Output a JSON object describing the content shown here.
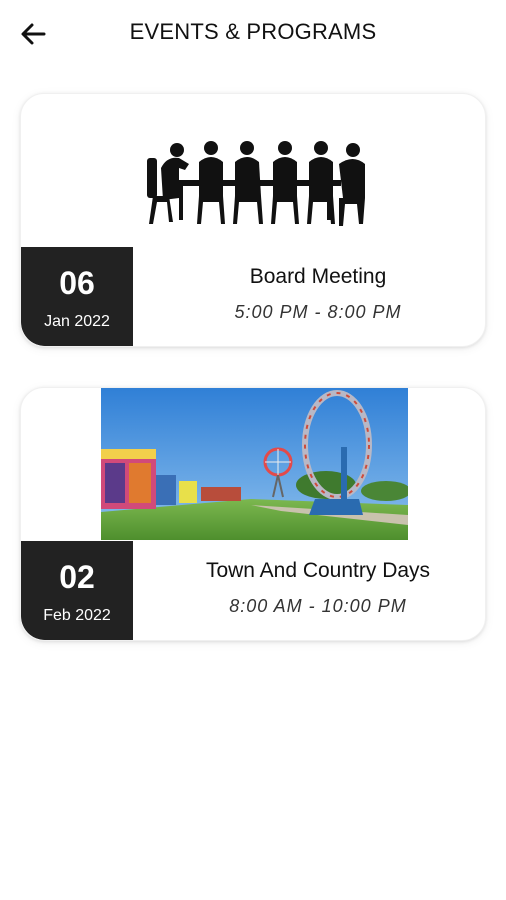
{
  "header": {
    "title": "EVENTS & PROGRAMS",
    "back_icon": "arrow-left-icon"
  },
  "events": [
    {
      "day": "06",
      "month_year": "Jan 2022",
      "name": "Board Meeting",
      "time": "5:00 PM - 8:00 PM",
      "image": "board-meeting-silhouette"
    },
    {
      "day": "02",
      "month_year": "Feb 2022",
      "name": "Town And Country Days",
      "time": "8:00 AM - 10:00 PM",
      "image": "carnival-fairground-photo"
    }
  ],
  "colors": {
    "date_block_bg": "#222222",
    "card_bg": "#ffffff",
    "sky": "#3a86d8",
    "grass": "#5a9e3a"
  }
}
